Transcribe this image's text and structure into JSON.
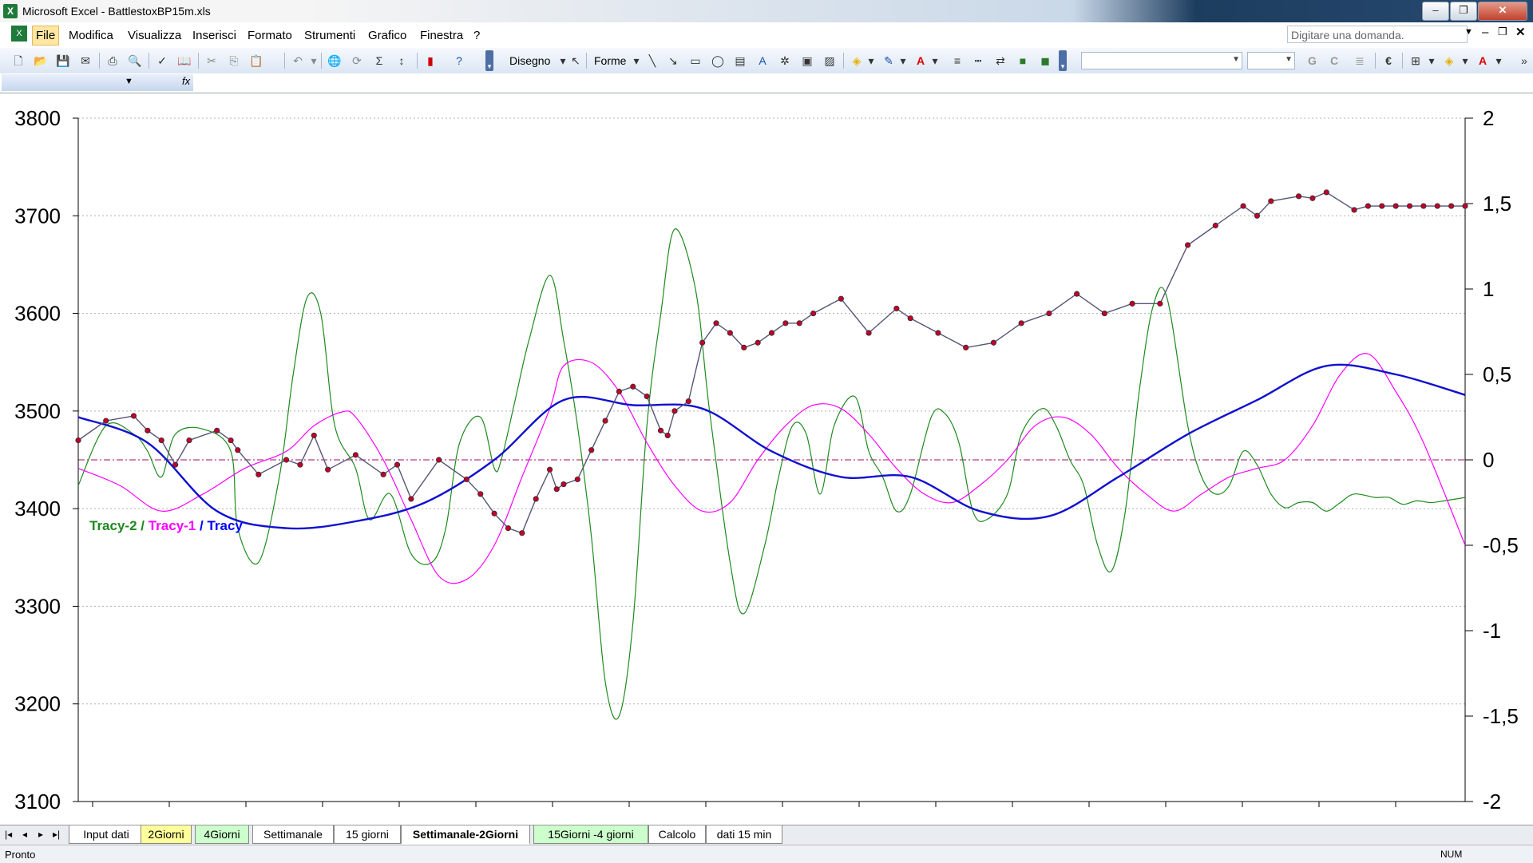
{
  "window": {
    "title": "Microsoft Excel - BattlestoxBP15m.xls",
    "ask_placeholder": "Digitare una domanda."
  },
  "menu": {
    "items": [
      "File",
      "Modifica",
      "Visualizza",
      "Inserisci",
      "Formato",
      "Strumenti",
      "Grafico",
      "Finestra",
      "?"
    ]
  },
  "toolbar": {
    "draw_label": "Disegno",
    "shapes_label": "Forme",
    "bold_label": "G",
    "italic_label": "C"
  },
  "sheets": {
    "tabs": [
      {
        "label": "Input dati",
        "color": "white"
      },
      {
        "label": "2Giorni",
        "color": "yellow"
      },
      {
        "label": "4Giorni",
        "color": "green"
      },
      {
        "label": "Settimanale",
        "color": "white"
      },
      {
        "label": "15 giorni",
        "color": "white"
      },
      {
        "label": "Settimanale-2Giorni",
        "color": "active"
      },
      {
        "label": "15Giorni -4 giorni",
        "color": "green"
      },
      {
        "label": "Calcolo",
        "color": "white"
      },
      {
        "label": "dati 15 min",
        "color": "white"
      }
    ]
  },
  "status": {
    "text": "Pronto",
    "num": "NUM"
  },
  "chart_data": {
    "type": "line",
    "title": "",
    "legend": {
      "parts": [
        {
          "text": "Tracy-2",
          "color": "#1e8a1e"
        },
        {
          "text": " / ",
          "color": "#1e8a1e"
        },
        {
          "text": "Tracy-1",
          "color": "#ff00ff"
        },
        {
          "text": " / ",
          "color": "#0000ff"
        },
        {
          "text": "Tracy",
          "color": "#0000ff"
        }
      ],
      "placement": "left-middle"
    },
    "y_left": {
      "range": [
        3100,
        3800
      ],
      "ticks": [
        "3100",
        "3200",
        "3300",
        "3400",
        "3500",
        "3600",
        "3700",
        "3800"
      ],
      "grid": true
    },
    "y_right": {
      "range": [
        -2,
        2
      ],
      "ticks": [
        "-2",
        "-1,5",
        "-1",
        "-0,5",
        "0",
        "0,5",
        "1",
        "1,5",
        "2"
      ]
    },
    "x_range": [
      0,
      1
    ],
    "zero_line": {
      "axis": "right",
      "value": 0,
      "color": "#b03a8a",
      "style": "dash-dot"
    },
    "series": [
      {
        "name": "Tracy-2",
        "axis": "right",
        "color": "#1e8a1e",
        "x": [
          0,
          0.02,
          0.04,
          0.05,
          0.06,
          0.07,
          0.09,
          0.11,
          0.115,
          0.13,
          0.145,
          0.155,
          0.165,
          0.175,
          0.185,
          0.2,
          0.21,
          0.225,
          0.24,
          0.255,
          0.265,
          0.275,
          0.29,
          0.3,
          0.305,
          0.315,
          0.325,
          0.34,
          0.35,
          0.36,
          0.37,
          0.38,
          0.39,
          0.4,
          0.41,
          0.42,
          0.43,
          0.445,
          0.455,
          0.47,
          0.48,
          0.495,
          0.505,
          0.515,
          0.525,
          0.535,
          0.545,
          0.56,
          0.57,
          0.58,
          0.59,
          0.6,
          0.615,
          0.625,
          0.635,
          0.645,
          0.655,
          0.67,
          0.68,
          0.695,
          0.705,
          0.715,
          0.725,
          0.735,
          0.745,
          0.755,
          0.765,
          0.775,
          0.785,
          0.8,
          0.81,
          0.82,
          0.83,
          0.84,
          0.85,
          0.86,
          0.87,
          0.88,
          0.89,
          0.9,
          0.91,
          0.92,
          0.935,
          0.945,
          0.955,
          0.965,
          0.975,
          0.985,
          1.0
        ],
        "y": [
          -0.15,
          0.2,
          0.15,
          0.05,
          -0.1,
          0.15,
          0.18,
          0.05,
          -0.4,
          -0.6,
          -0.1,
          0.5,
          0.95,
          0.85,
          0.2,
          -0.05,
          -0.35,
          -0.2,
          -0.55,
          -0.6,
          -0.4,
          0.1,
          0.25,
          -0.05,
          0.0,
          0.35,
          0.7,
          1.08,
          0.7,
          0.2,
          -0.45,
          -1.3,
          -1.5,
          -0.95,
          0.2,
          0.85,
          1.35,
          1.0,
          0.3,
          -0.6,
          -0.9,
          -0.5,
          -0.1,
          0.2,
          0.15,
          -0.2,
          0.2,
          0.37,
          0.05,
          -0.1,
          -0.3,
          -0.2,
          0.25,
          0.27,
          0.1,
          -0.3,
          -0.35,
          -0.2,
          0.15,
          0.3,
          0.2,
          0.0,
          -0.15,
          -0.5,
          -0.65,
          -0.3,
          0.4,
          0.9,
          0.95,
          0.2,
          -0.1,
          -0.2,
          -0.15,
          0.05,
          -0.03,
          -0.2,
          -0.28,
          -0.25,
          -0.25,
          -0.3,
          -0.25,
          -0.2,
          -0.22,
          -0.22,
          -0.26,
          -0.24,
          -0.25,
          -0.24,
          -0.22
        ]
      },
      {
        "name": "Tracy-1",
        "axis": "right",
        "color": "#ff00ff",
        "x": [
          0,
          0.03,
          0.06,
          0.09,
          0.12,
          0.15,
          0.17,
          0.19,
          0.2,
          0.22,
          0.24,
          0.26,
          0.28,
          0.3,
          0.32,
          0.34,
          0.35,
          0.37,
          0.39,
          0.41,
          0.43,
          0.45,
          0.47,
          0.49,
          0.51,
          0.53,
          0.55,
          0.57,
          0.59,
          0.61,
          0.63,
          0.65,
          0.67,
          0.69,
          0.71,
          0.73,
          0.75,
          0.77,
          0.79,
          0.81,
          0.83,
          0.85,
          0.87,
          0.89,
          0.91,
          0.93,
          0.95,
          0.97,
          1.0
        ],
        "y": [
          -0.05,
          -0.15,
          -0.3,
          -0.2,
          -0.05,
          0.05,
          0.2,
          0.28,
          0.25,
          0.0,
          -0.35,
          -0.68,
          -0.7,
          -0.5,
          -0.1,
          0.3,
          0.55,
          0.57,
          0.4,
          0.1,
          -0.15,
          -0.3,
          -0.25,
          0.0,
          0.2,
          0.32,
          0.3,
          0.15,
          -0.05,
          -0.2,
          -0.25,
          -0.15,
          0.0,
          0.2,
          0.25,
          0.15,
          -0.05,
          -0.2,
          -0.3,
          -0.2,
          -0.1,
          -0.05,
          0.0,
          0.2,
          0.5,
          0.62,
          0.4,
          0.1,
          -0.5
        ]
      },
      {
        "name": "Tracy",
        "axis": "right",
        "color": "#1010d0",
        "x": [
          0,
          0.05,
          0.1,
          0.15,
          0.2,
          0.25,
          0.3,
          0.35,
          0.4,
          0.45,
          0.5,
          0.55,
          0.6,
          0.65,
          0.7,
          0.75,
          0.8,
          0.85,
          0.9,
          0.95,
          1.0
        ],
        "y": [
          0.25,
          0.1,
          -0.3,
          -0.4,
          -0.36,
          -0.25,
          0.0,
          0.35,
          0.32,
          0.3,
          0.05,
          -0.1,
          -0.1,
          -0.3,
          -0.33,
          -0.1,
          0.15,
          0.35,
          0.55,
          0.5,
          0.38
        ]
      },
      {
        "name": "price",
        "axis": "left",
        "color": "#c0002a",
        "x": [
          0,
          0.02,
          0.04,
          0.05,
          0.06,
          0.07,
          0.08,
          0.1,
          0.11,
          0.115,
          0.13,
          0.15,
          0.16,
          0.17,
          0.18,
          0.2,
          0.22,
          0.23,
          0.24,
          0.26,
          0.28,
          0.29,
          0.3,
          0.31,
          0.32,
          0.33,
          0.34,
          0.345,
          0.35,
          0.36,
          0.37,
          0.38,
          0.39,
          0.4,
          0.41,
          0.42,
          0.425,
          0.43,
          0.44,
          0.45,
          0.46,
          0.47,
          0.48,
          0.49,
          0.5,
          0.51,
          0.52,
          0.53,
          0.55,
          0.57,
          0.59,
          0.6,
          0.62,
          0.64,
          0.66,
          0.68,
          0.7,
          0.72,
          0.74,
          0.76,
          0.78,
          0.8,
          0.82,
          0.84,
          0.85,
          0.86,
          0.88,
          0.89,
          0.9,
          0.92,
          0.93,
          0.94,
          0.95,
          0.96,
          0.97,
          0.98,
          0.99,
          1.0
        ],
        "y": [
          3470,
          3490,
          3495,
          3480,
          3470,
          3445,
          3470,
          3480,
          3470,
          3460,
          3435,
          3450,
          3445,
          3475,
          3440,
          3455,
          3435,
          3445,
          3410,
          3450,
          3430,
          3415,
          3395,
          3380,
          3375,
          3410,
          3440,
          3420,
          3425,
          3430,
          3460,
          3490,
          3520,
          3525,
          3515,
          3480,
          3475,
          3500,
          3510,
          3570,
          3590,
          3580,
          3565,
          3570,
          3580,
          3590,
          3590,
          3600,
          3615,
          3580,
          3605,
          3595,
          3580,
          3565,
          3570,
          3590,
          3600,
          3620,
          3600,
          3610,
          3610,
          3670,
          3690,
          3710,
          3700,
          3715,
          3720,
          3718,
          3724,
          3706,
          3710,
          3710,
          3710,
          3710,
          3710,
          3710,
          3710,
          3710
        ]
      }
    ]
  }
}
